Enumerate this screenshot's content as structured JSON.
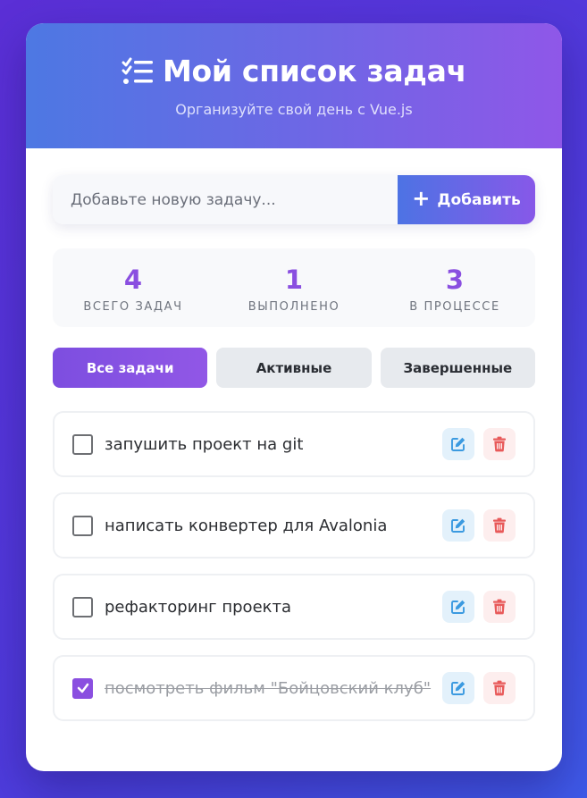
{
  "header": {
    "title": "Мой список задач",
    "subtitle": "Организуйте свой день с Vue.js",
    "icon": "task-list-icon"
  },
  "add_task": {
    "placeholder": "Добавьте новую задачу...",
    "value": "",
    "button_label": "Добавить",
    "button_icon": "plus-icon"
  },
  "stats": [
    {
      "value": "4",
      "label": "ВСЕГО ЗАДАЧ"
    },
    {
      "value": "1",
      "label": "ВЫПОЛНЕНО"
    },
    {
      "value": "3",
      "label": "В ПРОЦЕССЕ"
    }
  ],
  "filters": [
    {
      "label": "Все задачи",
      "active": true
    },
    {
      "label": "Активные",
      "active": false
    },
    {
      "label": "Завершенные",
      "active": false
    }
  ],
  "tasks": [
    {
      "text": "запушить проект на git",
      "done": false
    },
    {
      "text": "написать конвертер для Avalonia",
      "done": false
    },
    {
      "text": "рефакторинг проекта",
      "done": false
    },
    {
      "text": "посмотреть фильм \"Бойцовский клуб\"",
      "done": true
    }
  ],
  "colors": {
    "accent": "#8a4fe0",
    "header_gradient_start": "#4d78e3",
    "header_gradient_end": "#8f57e8",
    "edit_icon": "#3b9ae0",
    "delete_icon": "#e85a5a"
  }
}
